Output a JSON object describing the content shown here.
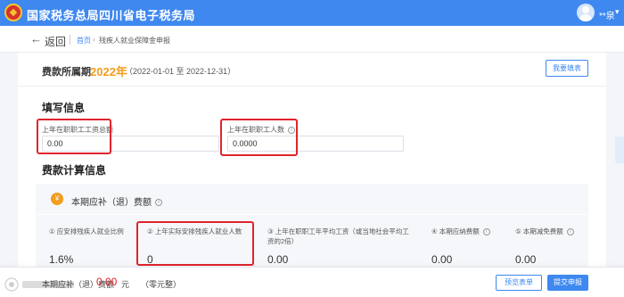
{
  "header": {
    "site_title": "国家税务总局四川省电子税务局",
    "user_name": "**泉",
    "caret": "▾"
  },
  "nav": {
    "back_arrow": "←",
    "back_label": "返回",
    "breadcrumb": {
      "home": "首页",
      "separator": "›",
      "current": "残疾人就业保障金申报"
    }
  },
  "period": {
    "label": "费款所属期",
    "year": "2022年",
    "range": "（2022-01-01 至 2022-12-31）",
    "help_button": "我要填表"
  },
  "fill_info": {
    "title": "填写信息",
    "fields": [
      {
        "label": "上年在职职工工资总额",
        "value": "0.00",
        "has_info": false
      },
      {
        "label": "上年在职职工人数",
        "value": "0.0000",
        "has_info": true
      }
    ]
  },
  "calc_info": {
    "title": "费款计算信息",
    "badge": "¥",
    "panel_title": "本期应补（退）费额",
    "columns": [
      {
        "label": "① 应安排残疾人就业比例",
        "value": "1.6%"
      },
      {
        "label": "② 上年实际安排残疾人就业人数",
        "value": "0"
      },
      {
        "label": "③ 上年在职职工年平均工资（或当地社会平均工资的2倍）",
        "value": "0.00"
      },
      {
        "label": "④ 本期应纳费额",
        "value": "0.00"
      },
      {
        "label": "⑤ 本期减免费额",
        "value": "0.00"
      }
    ]
  },
  "footer": {
    "label": "本期应补（退）费额",
    "amount": "0.00",
    "unit": "元",
    "amount_words": "（零元整）",
    "preview_button": "预览表单",
    "submit_button": "提交申报"
  },
  "colors": {
    "primary": "#3e88f0",
    "accent_orange": "#f29d1e",
    "highlight_red": "#e0242c"
  },
  "icons": {
    "logo": "tax-emblem-icon",
    "avatar": "user-avatar-icon",
    "back": "arrow-left-icon",
    "info": "info-circle-icon"
  },
  "watermark": {
    "text": "大众汽车报"
  }
}
